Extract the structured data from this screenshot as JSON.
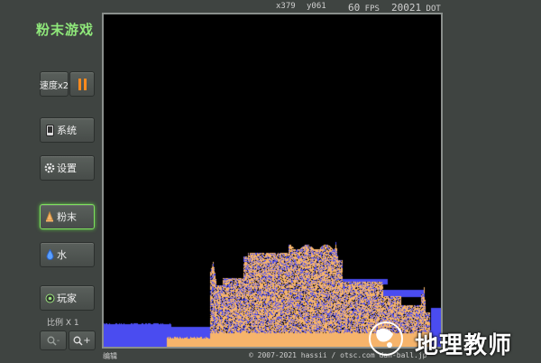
{
  "app": {
    "title": "粉末游戏"
  },
  "toolbar": {
    "speed_label": "速度x2",
    "system_label": "系统",
    "settings_label": "设置",
    "powder_label": "粉末",
    "water_label": "水",
    "player_label": "玩家",
    "scale_label": "比例 X 1",
    "zoom_out_label": "-",
    "zoom_in_label": "+"
  },
  "status": {
    "x_readout": "x379",
    "y_readout": "y061",
    "fps_value": "60",
    "fps_unit": "FPS",
    "dot_value": "20021",
    "dot_unit": "DOT"
  },
  "footer": {
    "left_text": "编辑",
    "right_text": "© 2007-2021 hassii / otsc.com dan-ball.jp"
  },
  "watermark": {
    "text": "地理教师"
  },
  "colors": {
    "accent_green": "#7ee05e",
    "pause_orange": "#ff8a1e",
    "powder": "#f6b46b",
    "water": "#4a4cf0",
    "canvas": "#000000"
  },
  "icons": {
    "system": "phone-icon",
    "settings": "gear-icon",
    "powder": "bell-powder-icon",
    "water": "water-drop-icon",
    "player": "player-icon",
    "zoom_out": "magnifier-minus-icon",
    "zoom_in": "magnifier-plus-icon"
  }
}
